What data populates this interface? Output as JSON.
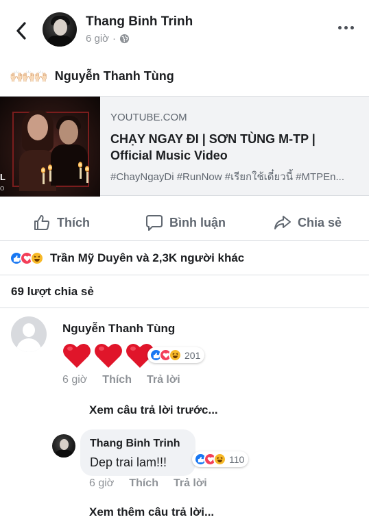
{
  "header": {
    "author_name": "Thang Binh Trinh",
    "timestamp": "6 giờ",
    "separator": "·",
    "privacy_icon": "globe-icon",
    "back_icon": "chevron-left-icon",
    "more_icon": "more-horizontal-icon"
  },
  "post": {
    "emoji": "🙌🏻🙌🏻🙌🏻",
    "text": "Nguyễn Thanh Tùng"
  },
  "link_card": {
    "domain": "YOUTUBE.COM",
    "title": "CHẠY NGAY ĐI | SƠN TÙNG M-TP | Official Music Video",
    "description": "#ChayNgayDi #RunNow #เรียกใช้เดี๋ยวนี้ #MTPEn...",
    "thumb_edge_text": "L",
    "thumb_edge_sub": "O"
  },
  "actions": {
    "like_label": "Thích",
    "comment_label": "Bình luận",
    "share_label": "Chia sẻ"
  },
  "reactions": {
    "summary": "Trần Mỹ Duyên và 2,3K người khác",
    "types": [
      "like",
      "love",
      "haha"
    ]
  },
  "shares": "69 lượt chia sẻ",
  "comment1": {
    "author": "Nguyễn Thanh Tùng",
    "content_emoji": "❤❤❤",
    "reaction_count": "201",
    "time": "6 giờ",
    "like_label": "Thích",
    "reply_label": "Trả lời",
    "see_previous": "Xem câu trả lời trước..."
  },
  "reply1": {
    "author": "Thang Binh Trinh",
    "text": "Dep trai lam!!!",
    "reaction_count": "110",
    "time": "6 giờ",
    "like_label": "Thích",
    "reply_label": "Trả lời",
    "see_more": "Xem thêm câu trả lời..."
  },
  "colors": {
    "like_blue": "#1877f2",
    "love_red": "#f33e58",
    "haha_yellow": "#f7b928",
    "heart_red": "#e0152a"
  }
}
